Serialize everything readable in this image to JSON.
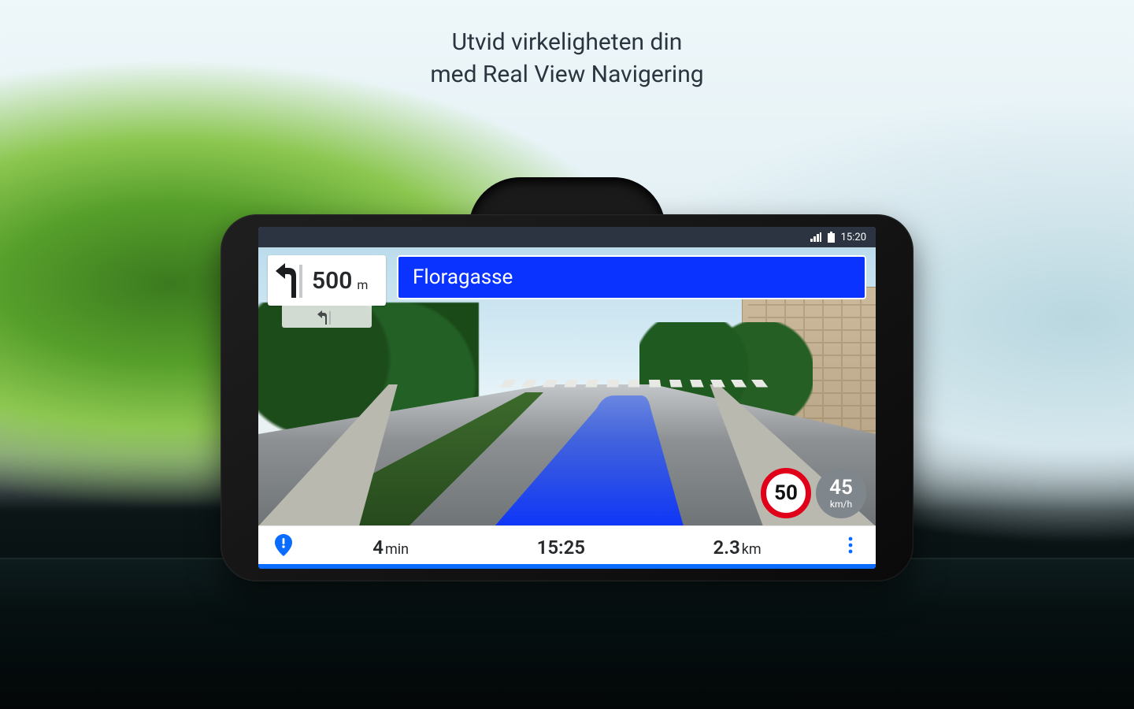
{
  "promo": {
    "line1": "Utvid virkeligheten din",
    "line2": "med Real View Navigering"
  },
  "statusbar": {
    "time": "15:20"
  },
  "turn": {
    "direction": "left",
    "distance_value": "500",
    "distance_unit": "m"
  },
  "lane": {
    "indicator": "left-then-straight"
  },
  "street": {
    "name": "Floragasse"
  },
  "speed": {
    "limit": "50",
    "current_value": "45",
    "current_unit": "km/h"
  },
  "bottom": {
    "remaining_time_value": "4",
    "remaining_time_unit": "min",
    "eta": "15:25",
    "remaining_distance_value": "2.3",
    "remaining_distance_unit": "km"
  },
  "colors": {
    "accent_blue": "#0a33ff",
    "speed_limit_ring": "#e1001a",
    "bottom_accent": "#0a6cff"
  }
}
